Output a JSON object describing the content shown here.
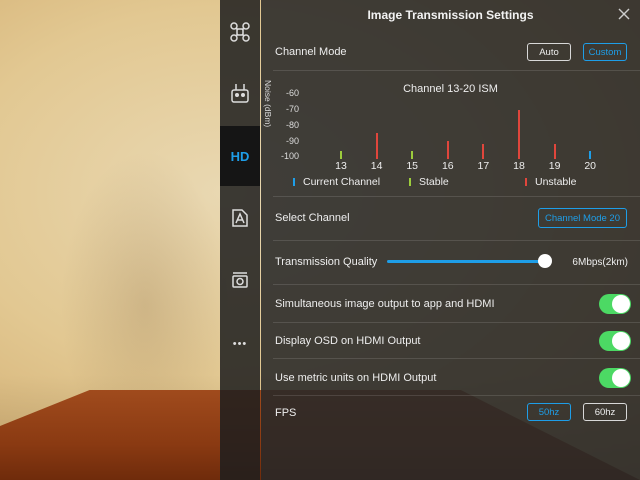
{
  "panel": {
    "title": "Image Transmission Settings"
  },
  "channel_mode": {
    "label": "Channel Mode",
    "auto_label": "Auto",
    "custom_label": "Custom",
    "selected": "Custom"
  },
  "chart_data": {
    "type": "bar",
    "title": "Channel 13-20 ISM",
    "ylabel": "Noise (dBm)",
    "yticks": [
      "-60",
      "-70",
      "-80",
      "-90",
      "-100"
    ],
    "ylim": [
      -100,
      -60
    ],
    "categories": [
      "13",
      "14",
      "15",
      "16",
      "17",
      "18",
      "19",
      "20"
    ],
    "values": [
      -95,
      -84,
      -95,
      -89,
      -91,
      -70,
      -91,
      -95
    ],
    "status": [
      "stable",
      "unstable",
      "stable",
      "unstable",
      "unstable",
      "unstable",
      "unstable",
      "current"
    ],
    "colors": {
      "current": "#1e9ee8",
      "stable": "#9ccc3c",
      "unstable": "#e0463c"
    },
    "legend": [
      {
        "key": "current",
        "label": "Current Channel"
      },
      {
        "key": "stable",
        "label": "Stable"
      },
      {
        "key": "unstable",
        "label": "Unstable"
      }
    ]
  },
  "select_channel": {
    "label": "Select Channel",
    "value": "Channel Mode 20"
  },
  "quality": {
    "label": "Transmission Quality",
    "value_text": "6Mbps(2km)",
    "level_percent": 100
  },
  "toggles": [
    {
      "label": "Simultaneous image output to app and HDMI",
      "on": true
    },
    {
      "label": "Display OSD on HDMI Output",
      "on": true
    },
    {
      "label": "Use metric units on HDMI Output",
      "on": true
    }
  ],
  "fps": {
    "label": "FPS",
    "options": [
      "50hz",
      "60hz"
    ],
    "selected": "50hz"
  },
  "sidebar": {
    "items": [
      {
        "name": "aircraft-icon"
      },
      {
        "name": "remote-controller-icon"
      },
      {
        "name": "hd-transmission-icon",
        "label": "HD"
      },
      {
        "name": "battery-settings-icon"
      },
      {
        "name": "camera-icon"
      },
      {
        "name": "more-icon",
        "label": "•••"
      }
    ],
    "active_index": 2
  },
  "accent_color": "#1e9ee8",
  "toggle_color": "#4cd964"
}
